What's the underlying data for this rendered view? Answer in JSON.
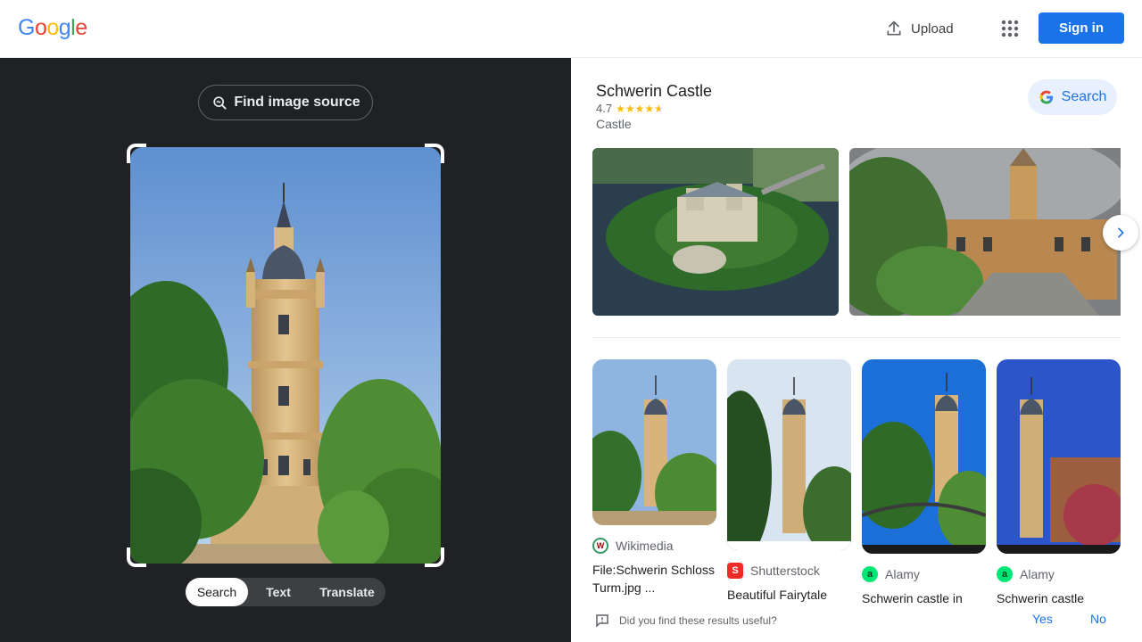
{
  "header": {
    "logo_letters": [
      "G",
      "o",
      "o",
      "g",
      "l",
      "e"
    ],
    "upload_label": "Upload",
    "apps_icon": "apps-grid-icon",
    "signin_label": "Sign in"
  },
  "left_panel": {
    "find_source_label": "Find image source",
    "mode_tabs": [
      {
        "label": "Search",
        "active": true
      },
      {
        "label": "Text",
        "active": false
      },
      {
        "label": "Translate",
        "active": false
      }
    ]
  },
  "knowledge_panel": {
    "title": "Schwerin Castle",
    "rating": "4.7",
    "rating_stars": 4.7,
    "type": "Castle",
    "search_label": "Search"
  },
  "results": [
    {
      "source": "Wikimedia",
      "title": "File:Schwerin Schloss Turm.jpg ..."
    },
    {
      "source": "Shutterstock",
      "title": "Beautiful Fairytale"
    },
    {
      "source": "Alamy",
      "title": "Schwerin castle in"
    },
    {
      "source": "Alamy",
      "title": "Schwerin castle"
    }
  ],
  "feedback": {
    "question": "Did you find these results useful?",
    "yes": "Yes",
    "no": "No"
  },
  "colors": {
    "accent": "#1a73e8",
    "dark_panel": "#202124",
    "star": "#fbbc04"
  }
}
